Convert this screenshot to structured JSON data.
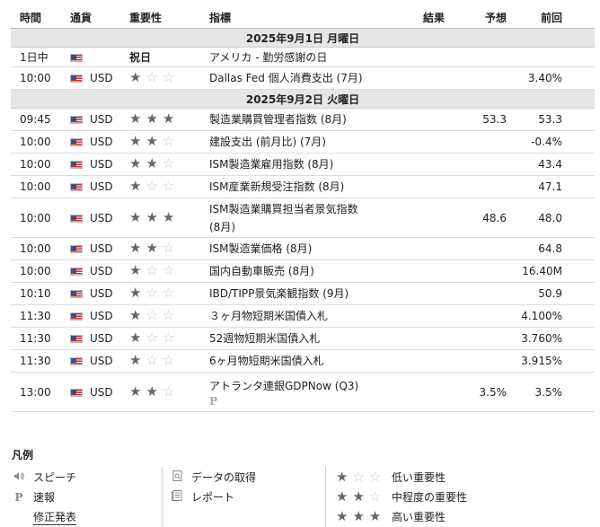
{
  "header": {
    "time": "時間",
    "currency": "通貨",
    "importance": "重要性",
    "indicator": "指標",
    "result": "結果",
    "forecast": "予想",
    "previous": "前回"
  },
  "days": [
    {
      "date": "2025年9月1日 月曜日",
      "events": [
        {
          "time": "1日中",
          "currency": "",
          "importance": 0,
          "holiday_label": "祝日",
          "indicator": "アメリカ - 勤労感謝の日",
          "result": "",
          "forecast": "",
          "previous": ""
        },
        {
          "time": "10:00",
          "currency": "USD",
          "importance": 1,
          "indicator": "Dallas Fed 個人消費支出 (7月)",
          "result": "",
          "forecast": "",
          "previous": "3.40%"
        }
      ]
    },
    {
      "date": "2025年9月2日 火曜日",
      "events": [
        {
          "time": "09:45",
          "currency": "USD",
          "importance": 3,
          "indicator": "製造業購買管理者指数 (8月)",
          "result": "",
          "forecast": "53.3",
          "previous": "53.3"
        },
        {
          "time": "10:00",
          "currency": "USD",
          "importance": 2,
          "indicator": "建設支出 (前月比) (7月)",
          "result": "",
          "forecast": "",
          "previous": "-0.4%"
        },
        {
          "time": "10:00",
          "currency": "USD",
          "importance": 2,
          "indicator": "ISM製造業雇用指数 (8月)",
          "result": "",
          "forecast": "",
          "previous": "43.4"
        },
        {
          "time": "10:00",
          "currency": "USD",
          "importance": 1,
          "indicator": "ISM産業新規受注指数 (8月)",
          "result": "",
          "forecast": "",
          "previous": "47.1"
        },
        {
          "time": "10:00",
          "currency": "USD",
          "importance": 3,
          "indicator": "ISM製造業購買担当者景気指数",
          "indicator_line2": "(8月)",
          "result": "",
          "forecast": "48.6",
          "previous": "48.0"
        },
        {
          "time": "10:00",
          "currency": "USD",
          "importance": 2,
          "indicator": "ISM製造業価格 (8月)",
          "result": "",
          "forecast": "",
          "previous": "64.8"
        },
        {
          "time": "10:00",
          "currency": "USD",
          "importance": 1,
          "indicator": "国内自動車販売 (8月)",
          "result": "",
          "forecast": "",
          "previous": "16.40M"
        },
        {
          "time": "10:10",
          "currency": "USD",
          "importance": 1,
          "indicator": "IBD/TIPP景気楽観指数 (9月)",
          "result": "",
          "forecast": "",
          "previous": "50.9"
        },
        {
          "time": "11:30",
          "currency": "USD",
          "importance": 1,
          "indicator": "３ヶ月物短期米国債入札",
          "result": "",
          "forecast": "",
          "previous": "4.100%"
        },
        {
          "time": "11:30",
          "currency": "USD",
          "importance": 1,
          "indicator": "52週物短期米国債入札",
          "result": "",
          "forecast": "",
          "previous": "3.760%"
        },
        {
          "time": "11:30",
          "currency": "USD",
          "importance": 1,
          "indicator": "6ヶ月物短期米国債入札",
          "result": "",
          "forecast": "",
          "previous": "3.915%"
        },
        {
          "time": "13:00",
          "currency": "USD",
          "importance": 2,
          "indicator": "アトランタ連銀GDPNow (Q3)",
          "preliminary_mark": "P",
          "result": "",
          "forecast": "3.5%",
          "previous": "3.5%"
        }
      ]
    }
  ],
  "legend": {
    "title": "凡例",
    "speech": "スピーチ",
    "preliminary": "速報",
    "revised": "修正発表",
    "data_fetch": "データの取得",
    "report": "レポート",
    "low": "低い重要性",
    "medium": "中程度の重要性",
    "high": "高い重要性",
    "speech_icon": "speaker-icon",
    "preliminary_icon": "P",
    "data_icon": "data-icon",
    "report_icon": "report-icon"
  }
}
